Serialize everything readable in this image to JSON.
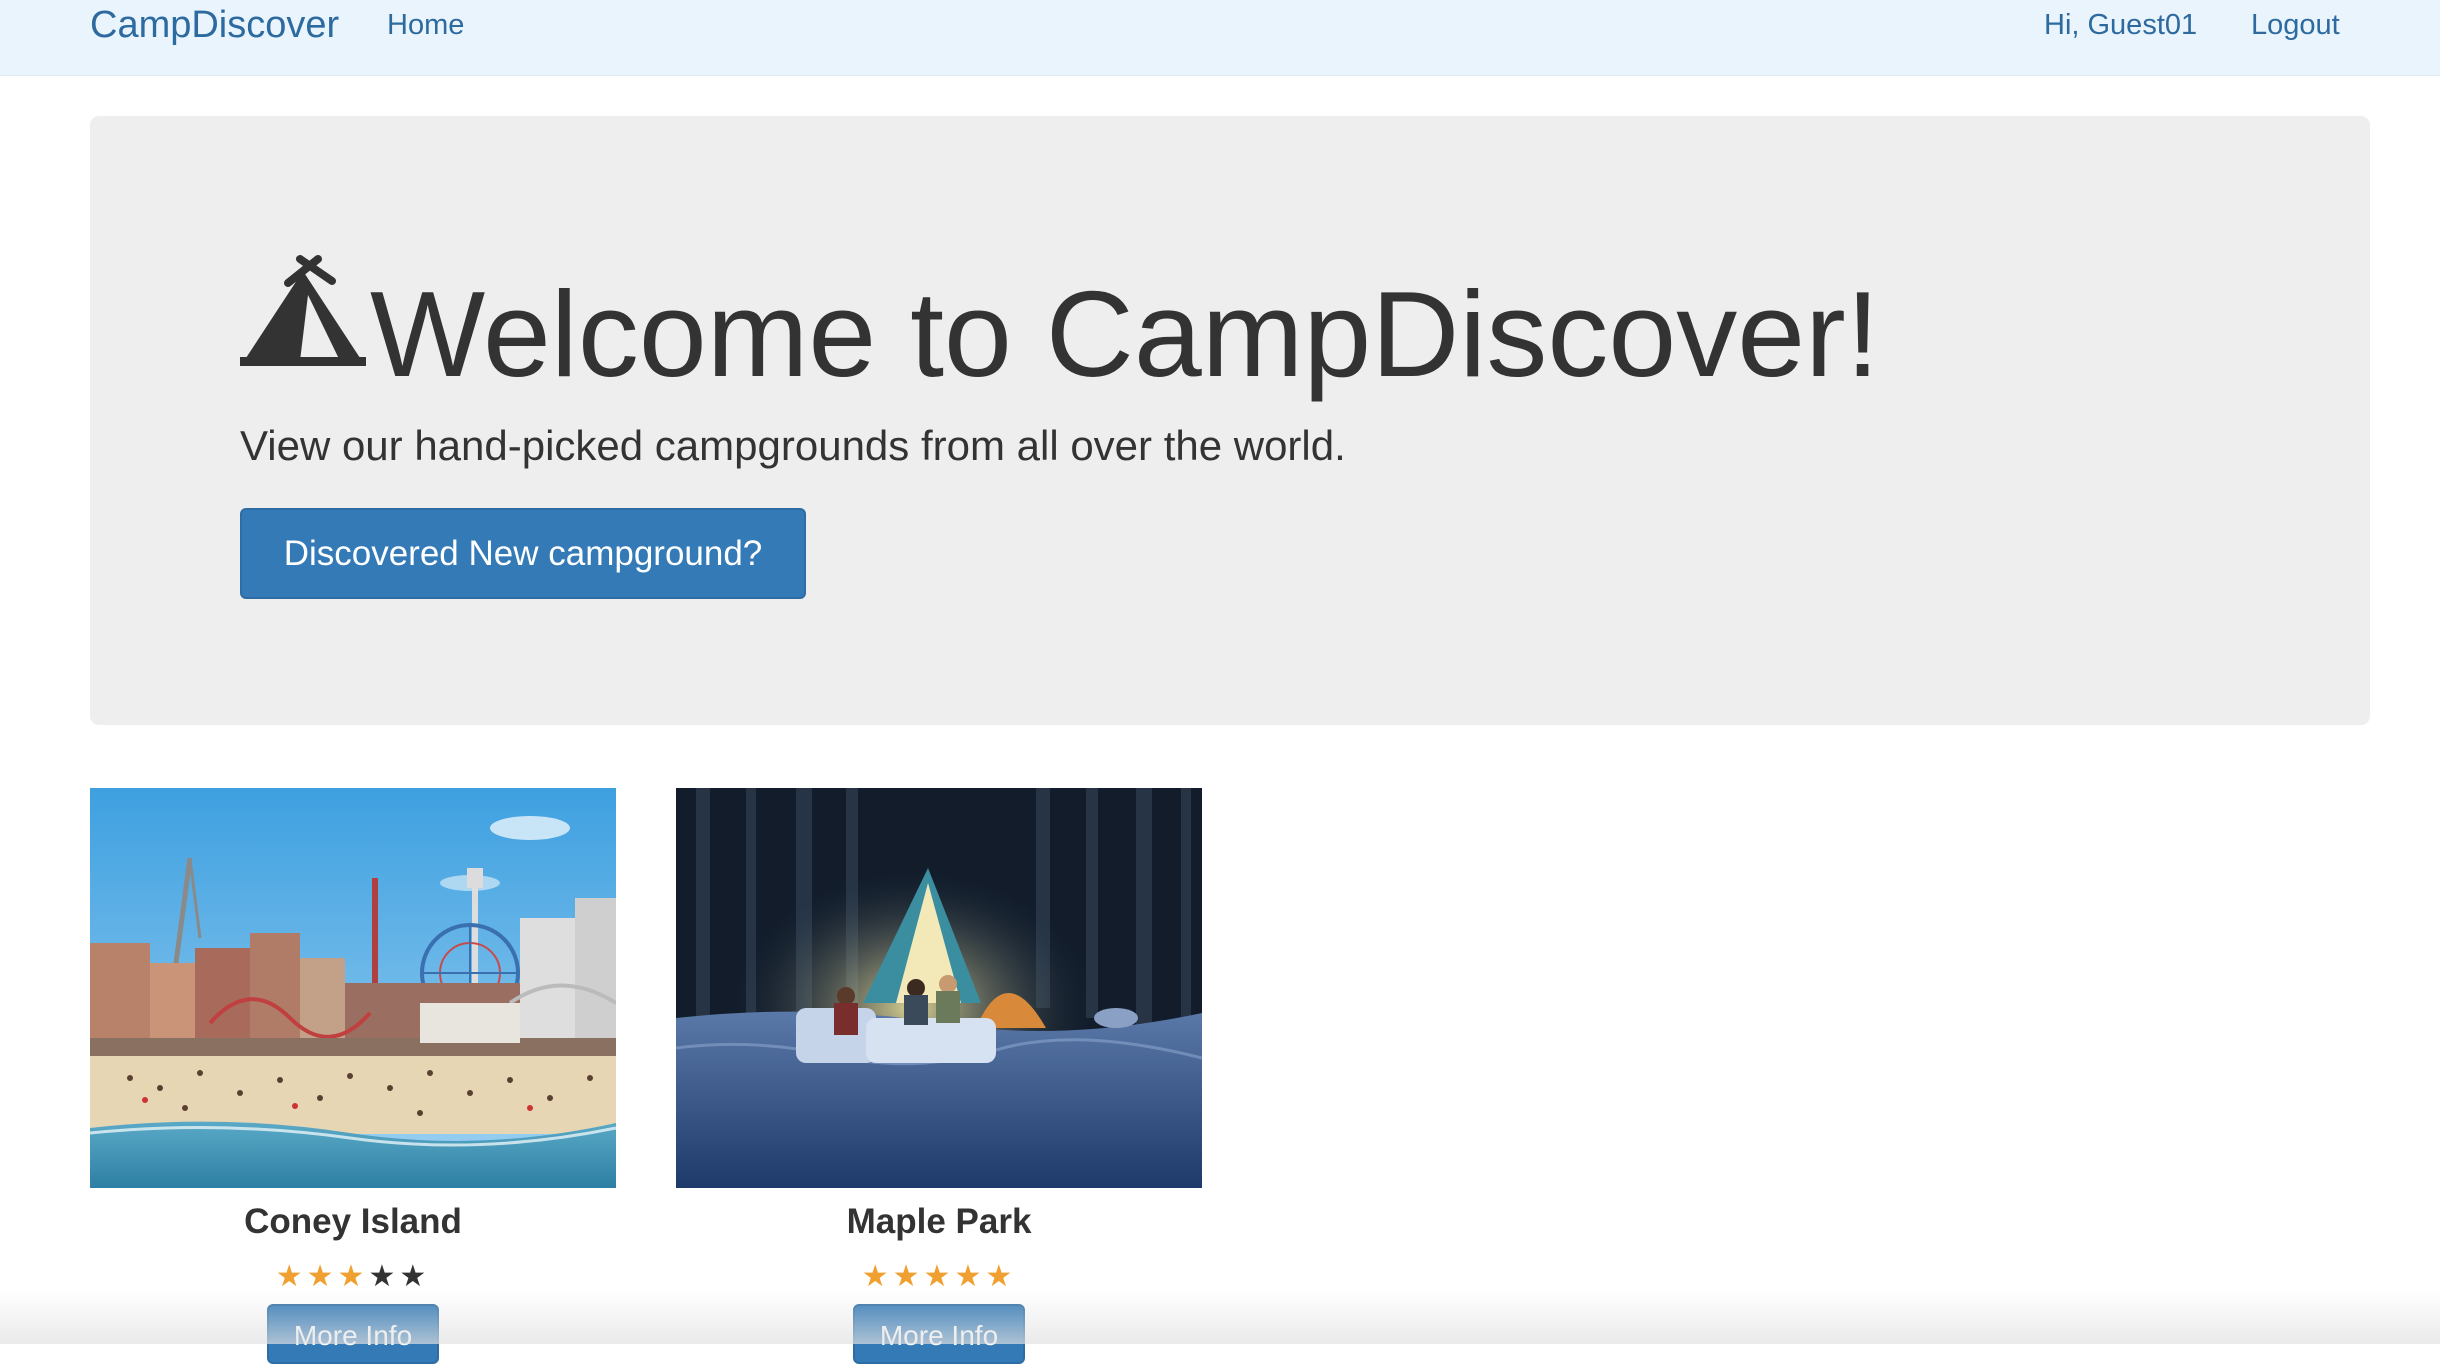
{
  "navbar": {
    "brand": "CampDiscover",
    "home_label": "Home",
    "greeting": "Hi, Guest01",
    "logout_label": "Logout"
  },
  "jumbotron": {
    "headline": "Welcome to CampDiscover!",
    "lead": "View our hand-picked campgrounds from all over the world.",
    "cta_label": "Discovered New campground?",
    "icon": "tent-icon"
  },
  "campgrounds": [
    {
      "name": "Coney Island",
      "rating": 3,
      "max_rating": 5,
      "button_label": "More Info"
    },
    {
      "name": "Maple Park",
      "rating": 5,
      "max_rating": 5,
      "button_label": "More Info"
    }
  ],
  "colors": {
    "primary": "#337ab7",
    "navbar_bg": "#eaf4fc",
    "jumbotron_bg": "#eeeeee",
    "star_active": "#f0a030",
    "star_inactive": "#333333"
  }
}
